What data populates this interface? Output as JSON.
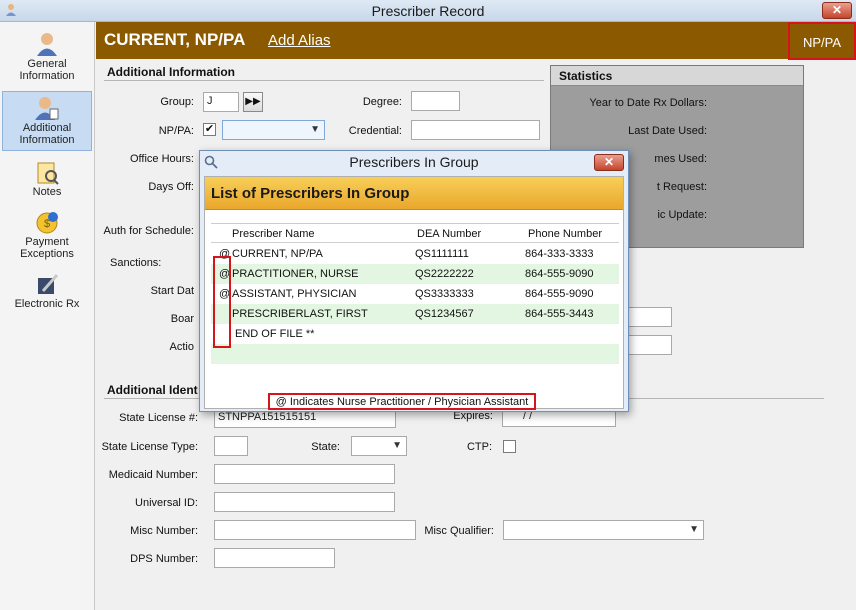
{
  "window": {
    "title": "Prescriber Record",
    "close_label": "✕"
  },
  "sidebar": {
    "items": [
      {
        "label": "General Information",
        "icon": "person-icon"
      },
      {
        "label": "Additional Information",
        "icon": "person-add-icon",
        "active": true
      },
      {
        "label": "Notes",
        "icon": "notes-icon"
      },
      {
        "label": "Payment Exceptions",
        "icon": "coin-icon"
      },
      {
        "label": "Electronic Rx",
        "icon": "pen-tablet-icon"
      }
    ]
  },
  "header": {
    "name": "CURRENT, NP/PA",
    "add_alias": "Add Alias",
    "badge": "NP/PA"
  },
  "additional_info": {
    "title": "Additional Information",
    "group_label": "Group:",
    "group_value": "J",
    "nppa_label": "NP/PA:",
    "nppa_checked": "✔",
    "degree_label": "Degree:",
    "credential_label": "Credential:",
    "office_hours_label": "Office Hours:",
    "days_off_label": "Days Off:",
    "auth_schedule_label": "Auth for Schedule:",
    "sanctions_label": "Sanctions:",
    "start_date_label": "Start Dat",
    "board_label": "Boar",
    "action_label": "Actio"
  },
  "statistics": {
    "title": "Statistics",
    "rows": [
      "Year to Date Rx Dollars:",
      "Last Date Used:",
      "mes Used:",
      "t Request:",
      "ic Update:"
    ]
  },
  "additional_ident": {
    "title": "Additional Ident",
    "state_license_label": "State License #:",
    "state_license_value": "STNPPA151515151",
    "expires_label": "Expires:",
    "expires_value": "/  /",
    "state_license_type_label": "State License Type:",
    "state_label": "State:",
    "ctp_label": "CTP:",
    "medicaid_label": "Medicaid Number:",
    "universal_id_label": "Universal ID:",
    "misc_number_label": "Misc Number:",
    "misc_qualifier_label": "Misc Qualifier:",
    "dps_label": "DPS Number:"
  },
  "dialog": {
    "title": "Prescribers In Group",
    "close_label": "✕",
    "banner": "List of Prescribers In Group",
    "columns": [
      "Prescriber Name",
      "DEA Number",
      "Phone Number"
    ],
    "rows": [
      {
        "marker": "@",
        "name": "CURRENT, NP/PA",
        "dea": "QS1111111",
        "phone": "864-333-3333"
      },
      {
        "marker": "@",
        "name": "PRACTITIONER, NURSE",
        "dea": "QS2222222",
        "phone": "864-555-9090"
      },
      {
        "marker": "@",
        "name": "ASSISTANT, PHYSICIAN",
        "dea": "QS3333333",
        "phone": "864-555-9090"
      },
      {
        "marker": "",
        "name": "PRESCRIBERLAST, FIRST",
        "dea": "QS1234567",
        "phone": "864-555-3443"
      }
    ],
    "end_of_file": "END OF FILE **",
    "legend": "@ Indicates Nurse Practitioner / Physician Assistant"
  }
}
